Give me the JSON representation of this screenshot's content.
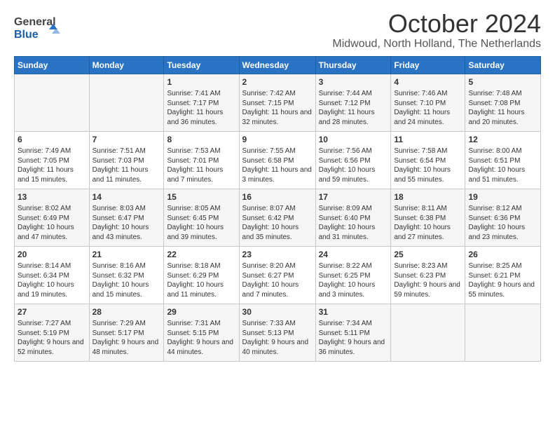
{
  "header": {
    "logo_general": "General",
    "logo_blue": "Blue",
    "month": "October 2024",
    "location": "Midwoud, North Holland, The Netherlands"
  },
  "days_of_week": [
    "Sunday",
    "Monday",
    "Tuesday",
    "Wednesday",
    "Thursday",
    "Friday",
    "Saturday"
  ],
  "weeks": [
    [
      {
        "day": "",
        "info": ""
      },
      {
        "day": "",
        "info": ""
      },
      {
        "day": "1",
        "info": "Sunrise: 7:41 AM\nSunset: 7:17 PM\nDaylight: 11 hours and 36 minutes."
      },
      {
        "day": "2",
        "info": "Sunrise: 7:42 AM\nSunset: 7:15 PM\nDaylight: 11 hours and 32 minutes."
      },
      {
        "day": "3",
        "info": "Sunrise: 7:44 AM\nSunset: 7:12 PM\nDaylight: 11 hours and 28 minutes."
      },
      {
        "day": "4",
        "info": "Sunrise: 7:46 AM\nSunset: 7:10 PM\nDaylight: 11 hours and 24 minutes."
      },
      {
        "day": "5",
        "info": "Sunrise: 7:48 AM\nSunset: 7:08 PM\nDaylight: 11 hours and 20 minutes."
      }
    ],
    [
      {
        "day": "6",
        "info": "Sunrise: 7:49 AM\nSunset: 7:05 PM\nDaylight: 11 hours and 15 minutes."
      },
      {
        "day": "7",
        "info": "Sunrise: 7:51 AM\nSunset: 7:03 PM\nDaylight: 11 hours and 11 minutes."
      },
      {
        "day": "8",
        "info": "Sunrise: 7:53 AM\nSunset: 7:01 PM\nDaylight: 11 hours and 7 minutes."
      },
      {
        "day": "9",
        "info": "Sunrise: 7:55 AM\nSunset: 6:58 PM\nDaylight: 11 hours and 3 minutes."
      },
      {
        "day": "10",
        "info": "Sunrise: 7:56 AM\nSunset: 6:56 PM\nDaylight: 10 hours and 59 minutes."
      },
      {
        "day": "11",
        "info": "Sunrise: 7:58 AM\nSunset: 6:54 PM\nDaylight: 10 hours and 55 minutes."
      },
      {
        "day": "12",
        "info": "Sunrise: 8:00 AM\nSunset: 6:51 PM\nDaylight: 10 hours and 51 minutes."
      }
    ],
    [
      {
        "day": "13",
        "info": "Sunrise: 8:02 AM\nSunset: 6:49 PM\nDaylight: 10 hours and 47 minutes."
      },
      {
        "day": "14",
        "info": "Sunrise: 8:03 AM\nSunset: 6:47 PM\nDaylight: 10 hours and 43 minutes."
      },
      {
        "day": "15",
        "info": "Sunrise: 8:05 AM\nSunset: 6:45 PM\nDaylight: 10 hours and 39 minutes."
      },
      {
        "day": "16",
        "info": "Sunrise: 8:07 AM\nSunset: 6:42 PM\nDaylight: 10 hours and 35 minutes."
      },
      {
        "day": "17",
        "info": "Sunrise: 8:09 AM\nSunset: 6:40 PM\nDaylight: 10 hours and 31 minutes."
      },
      {
        "day": "18",
        "info": "Sunrise: 8:11 AM\nSunset: 6:38 PM\nDaylight: 10 hours and 27 minutes."
      },
      {
        "day": "19",
        "info": "Sunrise: 8:12 AM\nSunset: 6:36 PM\nDaylight: 10 hours and 23 minutes."
      }
    ],
    [
      {
        "day": "20",
        "info": "Sunrise: 8:14 AM\nSunset: 6:34 PM\nDaylight: 10 hours and 19 minutes."
      },
      {
        "day": "21",
        "info": "Sunrise: 8:16 AM\nSunset: 6:32 PM\nDaylight: 10 hours and 15 minutes."
      },
      {
        "day": "22",
        "info": "Sunrise: 8:18 AM\nSunset: 6:29 PM\nDaylight: 10 hours and 11 minutes."
      },
      {
        "day": "23",
        "info": "Sunrise: 8:20 AM\nSunset: 6:27 PM\nDaylight: 10 hours and 7 minutes."
      },
      {
        "day": "24",
        "info": "Sunrise: 8:22 AM\nSunset: 6:25 PM\nDaylight: 10 hours and 3 minutes."
      },
      {
        "day": "25",
        "info": "Sunrise: 8:23 AM\nSunset: 6:23 PM\nDaylight: 9 hours and 59 minutes."
      },
      {
        "day": "26",
        "info": "Sunrise: 8:25 AM\nSunset: 6:21 PM\nDaylight: 9 hours and 55 minutes."
      }
    ],
    [
      {
        "day": "27",
        "info": "Sunrise: 7:27 AM\nSunset: 5:19 PM\nDaylight: 9 hours and 52 minutes."
      },
      {
        "day": "28",
        "info": "Sunrise: 7:29 AM\nSunset: 5:17 PM\nDaylight: 9 hours and 48 minutes."
      },
      {
        "day": "29",
        "info": "Sunrise: 7:31 AM\nSunset: 5:15 PM\nDaylight: 9 hours and 44 minutes."
      },
      {
        "day": "30",
        "info": "Sunrise: 7:33 AM\nSunset: 5:13 PM\nDaylight: 9 hours and 40 minutes."
      },
      {
        "day": "31",
        "info": "Sunrise: 7:34 AM\nSunset: 5:11 PM\nDaylight: 9 hours and 36 minutes."
      },
      {
        "day": "",
        "info": ""
      },
      {
        "day": "",
        "info": ""
      }
    ]
  ]
}
